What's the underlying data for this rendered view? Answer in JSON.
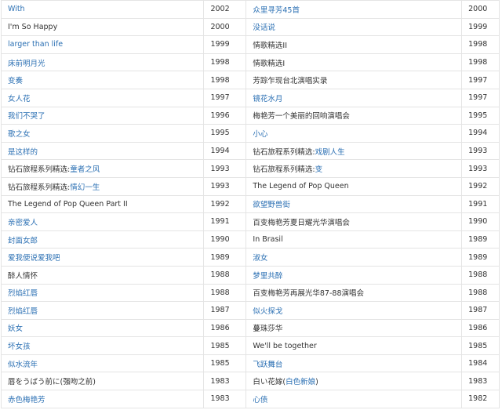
{
  "link_color": "#2a6fb3",
  "text_color": "#333333",
  "rows": [
    {
      "left": {
        "segments": [
          {
            "text": "With",
            "link": true
          }
        ]
      },
      "left_year": "2002",
      "right": {
        "segments": [
          {
            "text": "众里寻芳45首",
            "link": true
          }
        ]
      },
      "right_year": "2000"
    },
    {
      "left": {
        "segments": [
          {
            "text": "I'm So Happy",
            "link": false
          }
        ]
      },
      "left_year": "2000",
      "right": {
        "segments": [
          {
            "text": "没话说",
            "link": true
          }
        ]
      },
      "right_year": "1999"
    },
    {
      "left": {
        "segments": [
          {
            "text": "larger than life",
            "link": true
          }
        ]
      },
      "left_year": "1999",
      "right": {
        "segments": [
          {
            "text": "情歌精选II",
            "link": false
          }
        ]
      },
      "right_year": "1998"
    },
    {
      "left": {
        "segments": [
          {
            "text": "床前明月光",
            "link": true
          }
        ]
      },
      "left_year": "1998",
      "right": {
        "segments": [
          {
            "text": "情歌精选I",
            "link": false
          }
        ]
      },
      "right_year": "1998"
    },
    {
      "left": {
        "segments": [
          {
            "text": "变奏",
            "link": true
          }
        ]
      },
      "left_year": "1998",
      "right": {
        "segments": [
          {
            "text": "芳踪乍现台北演唱实录",
            "link": false
          }
        ]
      },
      "right_year": "1997"
    },
    {
      "left": {
        "segments": [
          {
            "text": "女人花",
            "link": true
          }
        ]
      },
      "left_year": "1997",
      "right": {
        "segments": [
          {
            "text": "镜花水月",
            "link": true
          }
        ]
      },
      "right_year": "1997"
    },
    {
      "left": {
        "segments": [
          {
            "text": "我们不哭了",
            "link": true
          }
        ]
      },
      "left_year": "1996",
      "right": {
        "segments": [
          {
            "text": "梅艳芳一个美丽的回响演唱会",
            "link": false
          }
        ]
      },
      "right_year": "1995"
    },
    {
      "left": {
        "segments": [
          {
            "text": "歌之女",
            "link": true
          }
        ]
      },
      "left_year": "1995",
      "right": {
        "segments": [
          {
            "text": "小心",
            "link": true
          }
        ]
      },
      "right_year": "1994"
    },
    {
      "left": {
        "segments": [
          {
            "text": "是这样的",
            "link": true
          }
        ]
      },
      "left_year": "1994",
      "right": {
        "segments": [
          {
            "text": "钻石旅程系列精选:",
            "link": false
          },
          {
            "text": "戏剧人生",
            "link": true
          }
        ]
      },
      "right_year": "1993"
    },
    {
      "left": {
        "segments": [
          {
            "text": "钻石旅程系列精选:",
            "link": false
          },
          {
            "text": "童者之风",
            "link": true
          }
        ]
      },
      "left_year": "1993",
      "right": {
        "segments": [
          {
            "text": "钻石旅程系列精选:",
            "link": false
          },
          {
            "text": "变",
            "link": true
          }
        ]
      },
      "right_year": "1993"
    },
    {
      "left": {
        "segments": [
          {
            "text": "钻石旅程系列精选:",
            "link": false
          },
          {
            "text": "情幻一生",
            "link": true
          }
        ]
      },
      "left_year": "1993",
      "right": {
        "segments": [
          {
            "text": "The Legend of Pop Queen",
            "link": false
          }
        ]
      },
      "right_year": "1992"
    },
    {
      "left": {
        "segments": [
          {
            "text": "The Legend of  Pop Queen Part II",
            "link": false
          }
        ]
      },
      "left_year": "1992",
      "right": {
        "segments": [
          {
            "text": "欲望野兽街",
            "link": true
          }
        ]
      },
      "right_year": "1991"
    },
    {
      "left": {
        "segments": [
          {
            "text": "亲密爱人",
            "link": true
          }
        ]
      },
      "left_year": "1991",
      "right": {
        "segments": [
          {
            "text": "百变梅艳芳夏日耀光华演唱会",
            "link": false
          }
        ]
      },
      "right_year": "1990"
    },
    {
      "left": {
        "segments": [
          {
            "text": "封面女郎",
            "link": true
          }
        ]
      },
      "left_year": "1990",
      "right": {
        "segments": [
          {
            "text": "In Brasil",
            "link": false
          }
        ]
      },
      "right_year": "1989"
    },
    {
      "left": {
        "segments": [
          {
            "text": "爱我便说爱我吧",
            "link": true
          }
        ]
      },
      "left_year": "1989",
      "right": {
        "segments": [
          {
            "text": "淑女",
            "link": true
          }
        ]
      },
      "right_year": "1989"
    },
    {
      "left": {
        "segments": [
          {
            "text": "醉人情怀",
            "link": false
          }
        ]
      },
      "left_year": "1988",
      "right": {
        "segments": [
          {
            "text": "梦里共醉",
            "link": true
          }
        ]
      },
      "right_year": "1988"
    },
    {
      "left": {
        "segments": [
          {
            "text": "烈焰红唇",
            "link": true
          }
        ]
      },
      "left_year": "1988",
      "right": {
        "segments": [
          {
            "text": "百变梅艳芳再展光华87-88演唱会",
            "link": false
          }
        ]
      },
      "right_year": "1988"
    },
    {
      "left": {
        "segments": [
          {
            "text": "烈焰红唇",
            "link": true
          }
        ]
      },
      "left_year": "1987",
      "right": {
        "segments": [
          {
            "text": "似火探戈",
            "link": true
          }
        ]
      },
      "right_year": "1987"
    },
    {
      "left": {
        "segments": [
          {
            "text": "妖女",
            "link": true
          }
        ]
      },
      "left_year": "1986",
      "right": {
        "segments": [
          {
            "text": "蔓珠莎华",
            "link": false
          }
        ]
      },
      "right_year": "1986"
    },
    {
      "left": {
        "segments": [
          {
            "text": "坏女孩",
            "link": true
          }
        ]
      },
      "left_year": "1985",
      "right": {
        "segments": [
          {
            "text": "We'll be together",
            "link": false
          }
        ]
      },
      "right_year": "1985"
    },
    {
      "left": {
        "segments": [
          {
            "text": "似水流年",
            "link": true
          }
        ]
      },
      "left_year": "1985",
      "right": {
        "segments": [
          {
            "text": "飞跃舞台",
            "link": true
          }
        ]
      },
      "right_year": "1984"
    },
    {
      "left": {
        "segments": [
          {
            "text": "唇をうばう前に(强吻之前)",
            "link": false
          }
        ]
      },
      "left_year": "1983",
      "right": {
        "segments": [
          {
            "text": "白い花嫁(",
            "link": false
          },
          {
            "text": "白色新娘",
            "link": true
          },
          {
            "text": ")",
            "link": false
          }
        ]
      },
      "right_year": "1983"
    },
    {
      "left": {
        "segments": [
          {
            "text": "赤色梅艳芳",
            "link": true
          }
        ]
      },
      "left_year": "1983",
      "right": {
        "segments": [
          {
            "text": "心债",
            "link": true
          }
        ]
      },
      "right_year": "1982"
    }
  ]
}
